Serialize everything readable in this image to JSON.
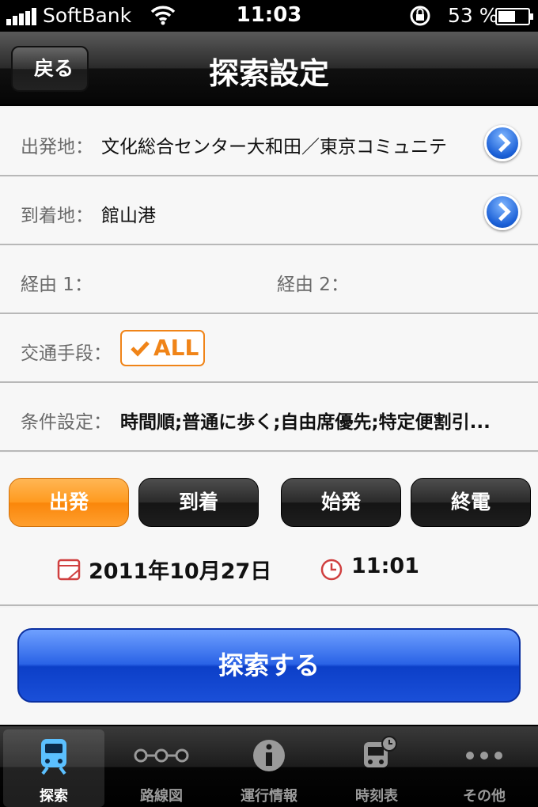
{
  "status_bar": {
    "carrier": "SoftBank",
    "time": "11:03",
    "battery_percent": "53 %"
  },
  "nav": {
    "back_label": "戻る",
    "title": "探索設定"
  },
  "form": {
    "departure_label": "出発地：",
    "departure_value": "文化総合センター大和田／東京コミュニテ",
    "arrival_label": "到着地：",
    "arrival_value": "館山港",
    "via1_label": "経由 1：",
    "via2_label": "経由 2：",
    "transport_label": "交通手段：",
    "transport_value": "ALL",
    "conditions_label": "条件設定：",
    "conditions_value": "時間順;普通に歩く;自由席優先;特定便割引..."
  },
  "modes": {
    "departure": "出発",
    "arrival": "到着",
    "first_train": "始発",
    "last_train": "終電"
  },
  "datetime": {
    "date": "2011年10月27日",
    "time": "11:01"
  },
  "search_button": "探索する",
  "tabs": [
    {
      "label": "探索",
      "icon": "train-icon"
    },
    {
      "label": "路線図",
      "icon": "route-map-icon"
    },
    {
      "label": "運行情報",
      "icon": "info-icon"
    },
    {
      "label": "時刻表",
      "icon": "timetable-icon"
    },
    {
      "label": "その他",
      "icon": "more-icon"
    }
  ],
  "colors": {
    "accent_orange": "#f08418",
    "search_blue": "#1a4fd8",
    "tab_selected": "#5bc0ff"
  }
}
